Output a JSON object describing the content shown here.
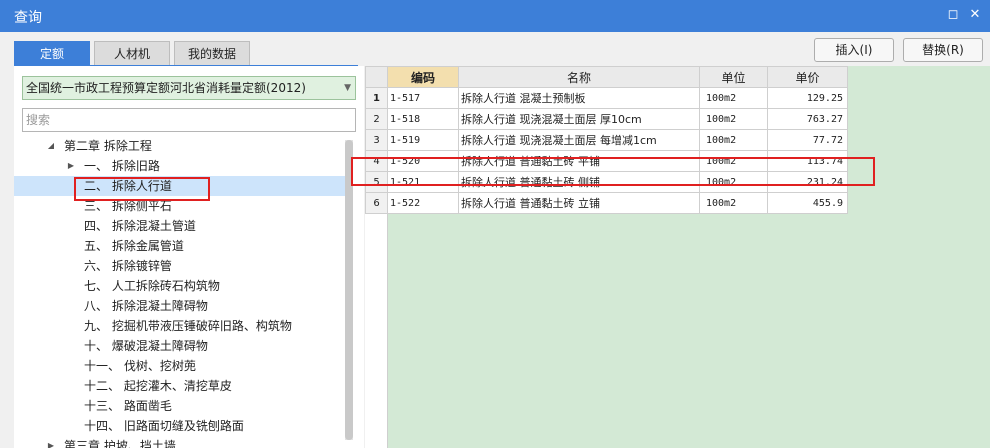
{
  "window": {
    "title": "查询"
  },
  "tabs": [
    {
      "label": "定额",
      "active": true
    },
    {
      "label": "人材机",
      "active": false
    },
    {
      "label": "我的数据",
      "active": false
    }
  ],
  "buttons": {
    "insert": "插入(I)",
    "replace": "替换(R)"
  },
  "quota_selector": {
    "value": "全国统一市政工程预算定额河北省消耗量定额(2012)"
  },
  "search": {
    "placeholder": "搜索"
  },
  "tree": [
    {
      "label": "第二章 拆除工程",
      "expanded": true
    },
    {
      "label": "一、 拆除旧路",
      "collapsed": true
    },
    {
      "label": "二、 拆除人行道",
      "selected": true
    },
    {
      "label": "三、 拆除侧平石"
    },
    {
      "label": "四、 拆除混凝土管道"
    },
    {
      "label": "五、 拆除金属管道"
    },
    {
      "label": "六、 拆除镀锌管"
    },
    {
      "label": "七、 人工拆除砖石构筑物"
    },
    {
      "label": "八、 拆除混凝土障碍物"
    },
    {
      "label": "九、 挖掘机带液压锤破碎旧路、构筑物"
    },
    {
      "label": "十、 爆破混凝土障碍物"
    },
    {
      "label": "十一、 伐树、挖树蔸"
    },
    {
      "label": "十二、 起挖灌木、清挖草皮"
    },
    {
      "label": "十三、 路面凿毛"
    },
    {
      "label": "十四、 旧路面切缝及铣刨路面"
    },
    {
      "label": "第三章 护坡、挡土墙",
      "collapsed": true
    }
  ],
  "table": {
    "columns": [
      "编码",
      "名称",
      "单位",
      "单价"
    ],
    "rows": [
      {
        "no": "1",
        "code": "1-517",
        "name": "拆除人行道 混凝土预制板",
        "unit": "100m2",
        "price": "129.25"
      },
      {
        "no": "2",
        "code": "1-518",
        "name": "拆除人行道 现浇混凝土面层 厚10cm",
        "unit": "100m2",
        "price": "763.27"
      },
      {
        "no": "3",
        "code": "1-519",
        "name": "拆除人行道 现浇混凝土面层 每增减1cm",
        "unit": "100m2",
        "price": "77.72"
      },
      {
        "no": "4",
        "code": "1-520",
        "name": "拆除人行道 普通黏土砖 平铺",
        "unit": "100m2",
        "price": "113.74"
      },
      {
        "no": "5",
        "code": "1-521",
        "name": "拆除人行道 普通黏土砖 侧铺",
        "unit": "100m2",
        "price": "231.24"
      },
      {
        "no": "6",
        "code": "1-522",
        "name": "拆除人行道 普通黏土砖 立铺",
        "unit": "100m2",
        "price": "455.9"
      }
    ]
  }
}
